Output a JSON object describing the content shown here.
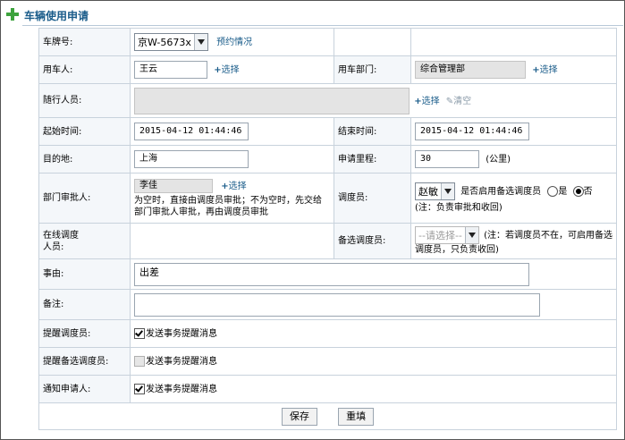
{
  "title": "车辆使用申请",
  "labels": {
    "plate": "车牌号:",
    "user": "用车人:",
    "dept": "用车部门:",
    "companions": "随行人员:",
    "start_time": "起始时间:",
    "end_time": "结束时间:",
    "destination": "目的地:",
    "mileage": "申请里程:",
    "approver": "部门审批人:",
    "dispatcher": "调度员:",
    "online": "在线调度人员:",
    "backup": "备选调度员:",
    "reason": "事由:",
    "remark": "备注:",
    "remind_dispatcher": "提醒调度员:",
    "remind_backup": "提醒备选调度员:",
    "notify_applicant": "通知申请人:"
  },
  "values": {
    "plate": "京W-5673x",
    "user": "王云",
    "dept": "综合管理部",
    "companions": "",
    "start_time": "2015-04-12 01:44:46",
    "end_time": "2015-04-12 01:44:46",
    "destination": "上海",
    "mileage": "30",
    "mileage_unit": "(公里)",
    "approver": "李佳",
    "dispatcher": "赵敏",
    "backup": "--请选择--",
    "reason": "出差",
    "remark": ""
  },
  "links": {
    "booking": "预约情况",
    "select": "选择",
    "clear": "清空"
  },
  "notes": {
    "approver": "为空时，直接由调度员审批；不为空时，先交给部门审批人审批，再由调度员审批",
    "enable_backup": "是否启用备选调度员",
    "yes": "是",
    "no": "否",
    "dispatcher_note": "(注：负责审批和收回)",
    "backup_note": "(注：若调度员不在，可启用备选调度员，只负责收回)"
  },
  "checks": {
    "send": "发送事务提醒消息"
  },
  "states": {
    "enable_backup": "no",
    "remind_dispatcher": true,
    "remind_backup": false,
    "notify_applicant": true
  },
  "buttons": {
    "save": "保存",
    "reset": "重填"
  }
}
